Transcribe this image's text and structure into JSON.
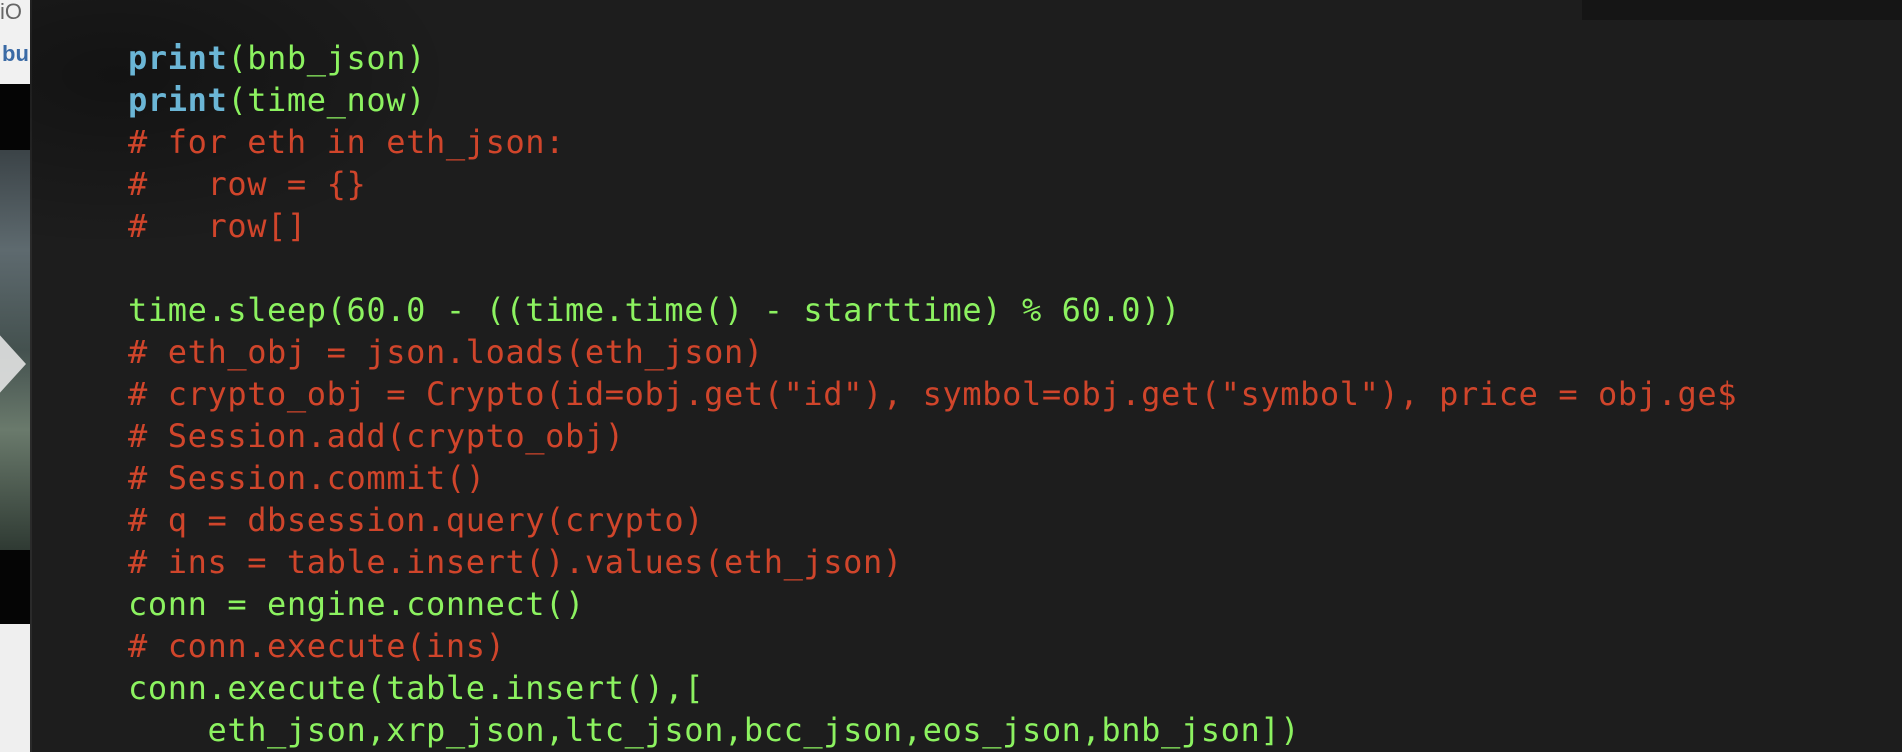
{
  "window": {
    "behind_text_line1": "iO",
    "behind_text_line2": "bu"
  },
  "editor": {
    "lines": [
      {
        "kind": "print",
        "keyword": "print",
        "rest": "(bnb_json)"
      },
      {
        "kind": "print",
        "keyword": "print",
        "rest": "(time_now)"
      },
      {
        "kind": "comment",
        "text": "# for eth in eth_json:"
      },
      {
        "kind": "comment",
        "text": "#   row = {}"
      },
      {
        "kind": "comment",
        "text": "#   row[]"
      },
      {
        "kind": "blank",
        "text": ""
      },
      {
        "kind": "code",
        "text": "time.sleep(60.0 - ((time.time() - starttime) % 60.0))"
      },
      {
        "kind": "comment",
        "text": "# eth_obj = json.loads(eth_json)"
      },
      {
        "kind": "comment",
        "text": "# crypto_obj = Crypto(id=obj.get(\"id\"), symbol=obj.get(\"symbol\"), price = obj.ge$"
      },
      {
        "kind": "comment",
        "text": "# Session.add(crypto_obj)"
      },
      {
        "kind": "comment",
        "text": "# Session.commit()"
      },
      {
        "kind": "comment",
        "text": "# q = dbsession.query(crypto)"
      },
      {
        "kind": "comment",
        "text": "# ins = table.insert().values(eth_json)"
      },
      {
        "kind": "code",
        "text": "conn = engine.connect()"
      },
      {
        "kind": "comment",
        "text": "# conn.execute(ins)"
      },
      {
        "kind": "code",
        "text": "conn.execute(table.insert(),["
      },
      {
        "kind": "code",
        "text": "    eth_json,xrp_json,ltc_json,bcc_json,eos_json,bnb_json])"
      }
    ]
  },
  "colors": {
    "background": "#1d1d1d",
    "keyword": "#6bb6d6",
    "code": "#8cf260",
    "comment": "#d0452b"
  }
}
